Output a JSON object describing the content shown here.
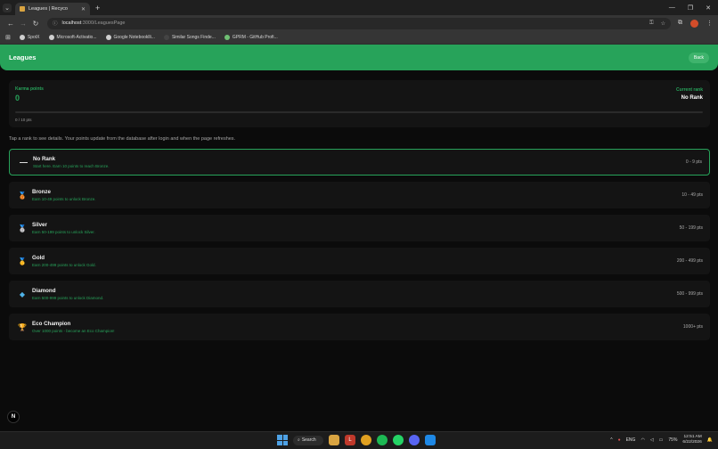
{
  "browser": {
    "tab_title": "Leagues | Recyco",
    "url_host": "localhost",
    "url_path": ":3000/LeaguesPage",
    "bookmarks": [
      "SpotX",
      "Microsoft-Activatio...",
      "Google Notebooklli...",
      "Similar Songs Finde...",
      "GPRM - GitHub Profi..."
    ]
  },
  "header": {
    "title": "Leagues",
    "back_label": "Back"
  },
  "karma": {
    "label": "Karma points",
    "value": "0",
    "current_rank_label": "Current rank",
    "current_rank": "No Rank",
    "progress_text": "0 / 10 pts",
    "progress_fraction": 0
  },
  "hint": "Tap a rank to see details. Your points update from the database after login and when the page refreshes.",
  "ranks": [
    {
      "name": "No Rank",
      "desc": "Start here. Earn 10 points to reach Bronze.",
      "pts": "0 - 9 pts",
      "icon": "dash-icon"
    },
    {
      "name": "Bronze",
      "desc": "Earn 10-49 points to unlock Bronze.",
      "pts": "10 - 49 pts",
      "icon": "bronze-medal-icon"
    },
    {
      "name": "Silver",
      "desc": "Earn 50-199 points to unlock Silver.",
      "pts": "50 - 199 pts",
      "icon": "silver-medal-icon"
    },
    {
      "name": "Gold",
      "desc": "Earn 200-499 points to unlock Gold.",
      "pts": "200 - 499 pts",
      "icon": "gold-medal-icon"
    },
    {
      "name": "Diamond",
      "desc": "Earn 500-999 points to unlock Diamond.",
      "pts": "500 - 999 pts",
      "icon": "diamond-icon"
    },
    {
      "name": "Eco Champion",
      "desc": "Over 1000 points - become an Eco Champion!",
      "pts": "1000+ pts",
      "icon": "trophy-icon"
    }
  ],
  "colors": {
    "accent": "#27a35a",
    "background": "#0b0b0b",
    "card": "#141414"
  },
  "taskbar": {
    "search_label": "Search",
    "lang": "ENG",
    "battery": "75%",
    "time": "12:51 AM",
    "date": "6/22/2026"
  },
  "devtools_avatar": "N"
}
